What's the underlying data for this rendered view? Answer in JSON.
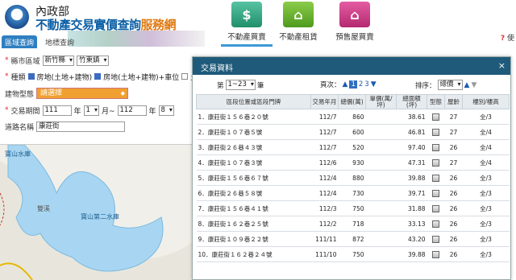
{
  "header": {
    "org": "內政部",
    "site_title_main": "不動產交易實價查詢",
    "site_title_accent": "服務網",
    "nav": [
      {
        "label": "不動產買賣",
        "icon": "house-dollar-icon"
      },
      {
        "label": "不動產租賃",
        "icon": "house-rent-icon"
      },
      {
        "label": "預售屋買賣",
        "icon": "crane-building-icon"
      }
    ],
    "help_text": "?",
    "help_suffix": "使"
  },
  "tabs": {
    "area": "區域查詢",
    "landmark": "地標查詢"
  },
  "search": {
    "county_label": "縣市區域",
    "county_value": "新竹縣",
    "town_value": "竹東鎮",
    "type_label": "種類",
    "type_options": [
      "房地(土地+建物)",
      "房地(土地+建物)+車位",
      "土"
    ],
    "building_label": "建物型態",
    "building_value": "請選擇",
    "period_label": "交易期間",
    "from_year": "111",
    "year_unit": "年",
    "from_month": "1",
    "month_unit_tilde": "月~",
    "to_year": "112",
    "to_month": "8",
    "road_label": "道路名稱",
    "road_value": "康莊街"
  },
  "map": {
    "labels": [
      "寶山水庫",
      "寶山第二水庫",
      "雙溪"
    ]
  },
  "modal": {
    "title": "交易資料",
    "close": "×",
    "page_select_prefix": "第",
    "page_select_value": "1~23",
    "page_select_suffix": "筆",
    "pager_label": "頁次：",
    "pages": [
      "1",
      "2",
      "3"
    ],
    "sort_label": "排序：",
    "sort_value": "總價",
    "columns": [
      "區段位置或區段門牌",
      "交易年月",
      "總價(萬)",
      "單價(萬/坪)",
      "總面積(坪)",
      "型態",
      "屋齡",
      "樓別/樓高"
    ],
    "rows": [
      {
        "addr": "1．康莊街１５６巷２０號",
        "date": "112/7",
        "total": "860",
        "unit": "",
        "area": "38.61",
        "age": "27",
        "floor": "全/3"
      },
      {
        "addr": "2．康莊街１０７巷５號",
        "date": "112/7",
        "total": "600",
        "unit": "",
        "area": "46.81",
        "age": "27",
        "floor": "全/4"
      },
      {
        "addr": "3．康莊街２６巷４３號",
        "date": "112/7",
        "total": "520",
        "unit": "",
        "area": "97.40",
        "age": "26",
        "floor": "全/4"
      },
      {
        "addr": "4．康莊街１０７巷３號",
        "date": "112/6",
        "total": "930",
        "unit": "",
        "area": "47.31",
        "age": "27",
        "floor": "全/4"
      },
      {
        "addr": "5．康莊街１５６巷６７號",
        "date": "112/4",
        "total": "880",
        "unit": "",
        "area": "39.88",
        "age": "26",
        "floor": "全/3"
      },
      {
        "addr": "6．康莊街２６巷５８號",
        "date": "112/4",
        "total": "730",
        "unit": "",
        "area": "39.71",
        "age": "26",
        "floor": "全/3"
      },
      {
        "addr": "7．康莊街１５６巷４１號",
        "date": "112/3",
        "total": "750",
        "unit": "",
        "area": "31.88",
        "age": "26",
        "floor": "全/3"
      },
      {
        "addr": "8．康莊街１６２巷２５號",
        "date": "112/2",
        "total": "718",
        "unit": "",
        "area": "33.13",
        "age": "26",
        "floor": "全/3"
      },
      {
        "addr": "9．康莊街１０９巷２２號",
        "date": "111/11",
        "total": "872",
        "unit": "",
        "area": "43.20",
        "age": "26",
        "floor": "全/3"
      },
      {
        "addr": "10．康莊街１６２巷２４號",
        "date": "111/10",
        "total": "750",
        "unit": "",
        "area": "39.88",
        "age": "26",
        "floor": "全/3"
      }
    ]
  }
}
